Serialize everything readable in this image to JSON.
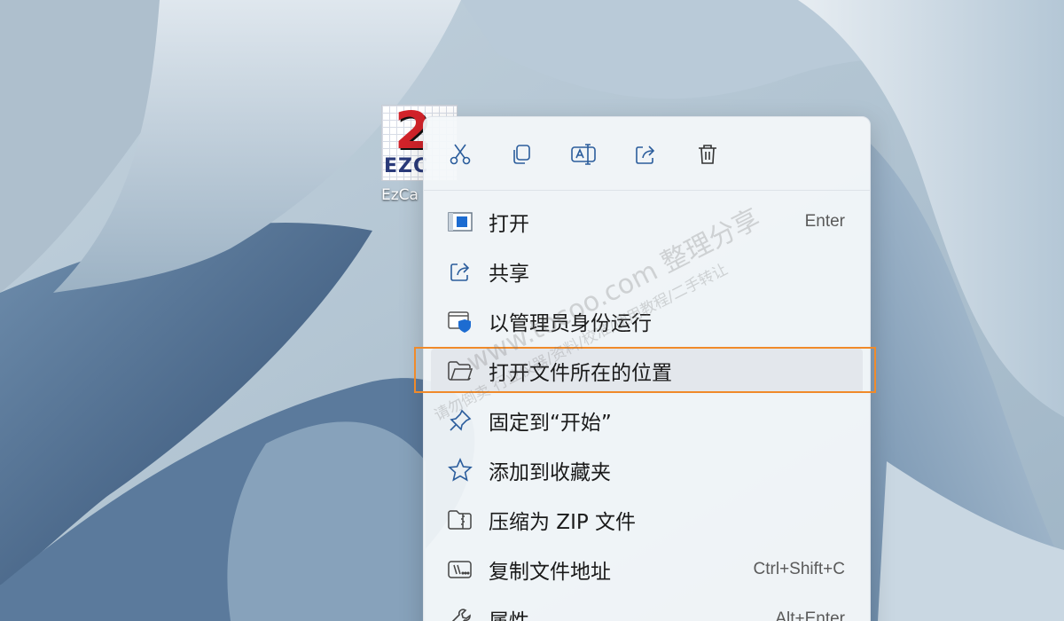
{
  "desktop": {
    "icon": {
      "number_glyph": "2",
      "brand_glyph": "EZC",
      "label": "EzCa"
    }
  },
  "context_menu": {
    "toolbar": [
      {
        "name": "cut-icon"
      },
      {
        "name": "copy-icon"
      },
      {
        "name": "rename-icon"
      },
      {
        "name": "share-icon"
      },
      {
        "name": "delete-icon"
      }
    ],
    "items": [
      {
        "label": "打开",
        "shortcut": "Enter",
        "icon": "open-icon"
      },
      {
        "label": "共享",
        "shortcut": "",
        "icon": "share-icon"
      },
      {
        "label": "以管理员身份运行",
        "shortcut": "",
        "icon": "admin-shield-icon"
      },
      {
        "label": "打开文件所在的位置",
        "shortcut": "",
        "icon": "folder-icon"
      },
      {
        "label": "固定到“开始”",
        "shortcut": "",
        "icon": "pin-icon"
      },
      {
        "label": "添加到收藏夹",
        "shortcut": "",
        "icon": "star-icon"
      },
      {
        "label": "压缩为 ZIP 文件",
        "shortcut": "",
        "icon": "zip-folder-icon"
      },
      {
        "label": "复制文件地址",
        "shortcut": "Ctrl+Shift+C",
        "icon": "copy-path-icon"
      },
      {
        "label": "属性",
        "shortcut": "Alt+Enter",
        "icon": "wrench-icon"
      }
    ],
    "highlighted_index": 3
  },
  "watermark": {
    "line1": "www.tocoo.com 整理分享",
    "line2": "请勿倒卖 行业仪器/资料/校准/使用教程/二手转让"
  },
  "colors": {
    "accent": "#2b6cc4",
    "focus_outline": "#f08a2a",
    "menu_bg": "#f4f7fa"
  }
}
